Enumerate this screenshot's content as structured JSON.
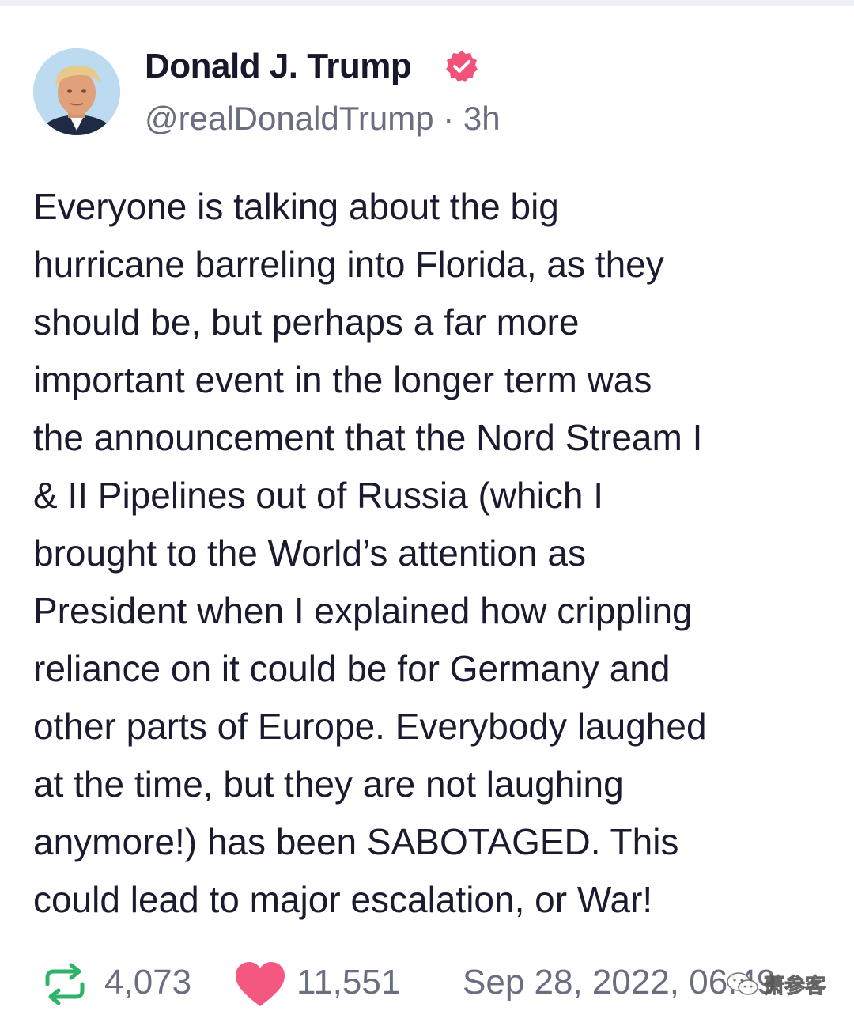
{
  "post": {
    "author": {
      "display_name": "Donald J. Trump",
      "handle": "@realDonaldTrump",
      "separator": " · ",
      "time_ago": "3h",
      "verified_icon": "verified-badge-icon",
      "verified_color": "#f2517a"
    },
    "body_lines": [
      "Everyone is talking about the big",
      "hurricane barreling into Florida, as they",
      "should be, but perhaps a far more",
      "important event in the longer term was",
      "the announcement that the Nord Stream I",
      "& II Pipelines out of Russia (which I",
      "brought to the World’s attention as",
      "President when I explained how crippling",
      "reliance on it could be for Germany and",
      "other parts of Europe. Everybody laughed",
      "at the time, but they are not laughing",
      "anymore!) has been SABOTAGED. This",
      "could lead to major escalation, or War!"
    ],
    "stats": {
      "repost_icon": "repost-icon",
      "repost_color": "#2fb36a",
      "reposts": "4,073",
      "like_icon": "heart-icon",
      "like_color": "#f4577f",
      "likes": "11,551",
      "timestamp": "Sep 28, 2022, 06:49"
    }
  },
  "watermark": {
    "text": "萧参客",
    "icon": "wechat-logo-icon"
  }
}
